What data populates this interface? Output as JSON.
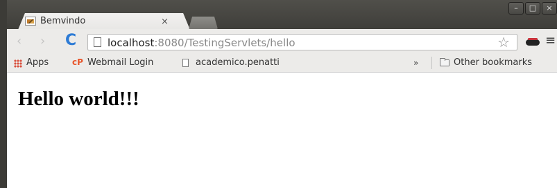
{
  "tab": {
    "title": "Bemvindo",
    "close_glyph": "×"
  },
  "window_controls": {
    "minimize": "–",
    "maximize": "□",
    "close": "×"
  },
  "toolbar": {
    "back_glyph": "‹",
    "forward_glyph": "›",
    "reload_glyph": "C",
    "url_host": "localhost",
    "url_rest": ":8080/TestingServlets/hello",
    "star_glyph": "☆",
    "menu_glyph": "≡"
  },
  "bookmarks": {
    "apps_label": "Apps",
    "cpanel_logo": "cP",
    "webmail_label": "Webmail Login",
    "academico_label": "academico.penatti",
    "overflow_glyph": "»",
    "other_label": "Other bookmarks"
  },
  "content": {
    "heading": "Hello world!!!"
  },
  "icons": {
    "favicon": "image-icon",
    "page": "page-icon",
    "extension": "disguise-extension-icon",
    "folder": "folder-icon",
    "apps": "apps-grid-icon"
  },
  "colors": {
    "tabstrip": "#45443f",
    "toolbar": "#ecebe9",
    "reload": "#2d7bd5",
    "apps_grid": "#d94f3d",
    "cpanel": "#e8552a"
  }
}
